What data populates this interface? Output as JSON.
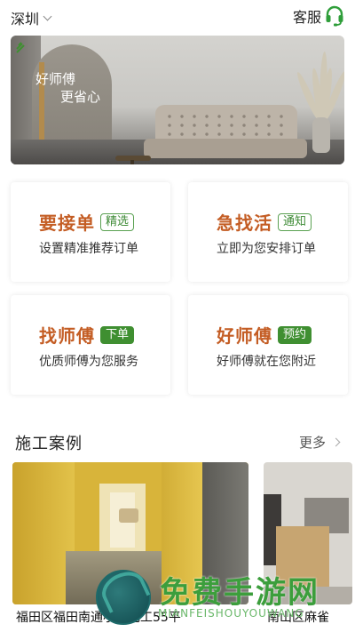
{
  "header": {
    "city": "深圳",
    "service_label": "客服",
    "service_icon": "headset-icon"
  },
  "banner": {
    "slogan_line1": "好师傅",
    "slogan_line2": "更省心"
  },
  "cards": [
    {
      "title": "要接单",
      "badge": "精选",
      "badge_style": "outline",
      "subtitle": "设置精准推荐订单"
    },
    {
      "title": "急找活",
      "badge": "通知",
      "badge_style": "outline",
      "subtitle": "立即为您安排订单"
    },
    {
      "title": "找师傅",
      "badge": "下单",
      "badge_style": "solid",
      "subtitle": "优质师傅为您服务"
    },
    {
      "title": "好师傅",
      "badge": "预约",
      "badge_style": "solid",
      "subtitle": "好师傅就在您附近"
    }
  ],
  "cases_section": {
    "title": "施工案例",
    "more_label": "更多",
    "items": [
      {
        "caption": "福田区福田南通小楼包工55平"
      },
      {
        "caption": "南山区麻雀"
      }
    ]
  },
  "watermark": {
    "text": "免费手游网",
    "subtext": "MIANFEISHOUYOUWANG"
  },
  "colors": {
    "accent_orange": "#c45d24",
    "accent_green": "#3f8f31",
    "headset_green": "#2f9e3a"
  }
}
